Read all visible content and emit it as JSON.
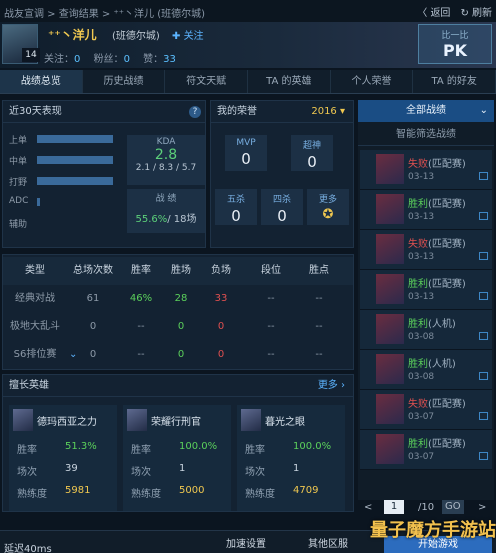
{
  "breadcrumb": "战友宣调 > 查询结果 > ⁺⁺丶洋儿 (班德尔城)",
  "top_right": {
    "back": "返回",
    "refresh": "刷新"
  },
  "player": {
    "level": "14",
    "name": "⁺⁺丶洋儿",
    "server": "(班德尔城)",
    "follow": "关注",
    "fans_label": "关注：",
    "fans": "0",
    "followers_label": "粉丝：",
    "followers": "0",
    "likes_label": "赞：",
    "likes": "33"
  },
  "pk": {
    "sub": "比一比",
    "label": "PK"
  },
  "tabs": [
    "战绩总览",
    "历史战绩",
    "符文天赋",
    "TA 的英雄",
    "个人荣誉",
    "TA 的好友"
  ],
  "recent": {
    "title": "近30天表现",
    "roles": [
      "上单",
      "中单",
      "打野",
      "ADC",
      "辅助"
    ],
    "role_share": [
      0.9,
      0.9,
      0.9,
      0.03,
      0
    ],
    "kda_label": "KDA",
    "kda": "2.8",
    "kda_detail": "2.1 / 8.3 / 5.7",
    "record_label": "战 绩",
    "winrate": "55.6%",
    "games": "/ 18场"
  },
  "honor": {
    "title": "我的荣誉",
    "year": "2016",
    "items": [
      {
        "label": "MVP",
        "value": "0"
      },
      {
        "label": "超神",
        "value": "0"
      },
      {
        "label": "五杀",
        "value": "0"
      },
      {
        "label": "四杀",
        "value": "0"
      },
      {
        "label": "更多",
        "value": ""
      }
    ]
  },
  "filter": {
    "all": "全部战绩",
    "smart": "智能筛选战绩"
  },
  "matches": [
    {
      "result": "失败",
      "mode": "(匹配赛)",
      "date": "03-13",
      "win": false
    },
    {
      "result": "胜利",
      "mode": "(匹配赛)",
      "date": "03-13",
      "win": true
    },
    {
      "result": "失败",
      "mode": "(匹配赛)",
      "date": "03-13",
      "win": false
    },
    {
      "result": "胜利",
      "mode": "(匹配赛)",
      "date": "03-13",
      "win": true
    },
    {
      "result": "胜利",
      "mode": "(人机)",
      "date": "03-08",
      "win": true
    },
    {
      "result": "胜利",
      "mode": "(人机)",
      "date": "03-08",
      "win": true
    },
    {
      "result": "失败",
      "mode": "(匹配赛)",
      "date": "03-07",
      "win": false
    },
    {
      "result": "胜利",
      "mode": "(匹配赛)",
      "date": "03-07",
      "win": true
    }
  ],
  "pager": {
    "prev": "<",
    "page": "1",
    "total": "/10",
    "go": "GO",
    "next": ">"
  },
  "table": {
    "headers": [
      "类型",
      "总场次数",
      "胜率",
      "胜场",
      "负场",
      "段位",
      "胜点"
    ],
    "rows": [
      [
        "经典对战",
        "61",
        "46%",
        "28",
        "33",
        "--",
        "--"
      ],
      [
        "极地大乱斗",
        "0",
        "--",
        "0",
        "0",
        "--",
        "--"
      ],
      [
        "S6排位赛",
        "0",
        "--",
        "0",
        "0",
        "--",
        "--"
      ]
    ]
  },
  "heroes": {
    "title": "擅长英雄",
    "more": "更多",
    "list": [
      {
        "name": "德玛西亚之力",
        "winrate": "51.3%",
        "games": "39",
        "mastery": "5981"
      },
      {
        "name": "荣耀行刑官",
        "winrate": "100.0%",
        "games": "1",
        "mastery": "5000"
      },
      {
        "name": "暮光之眼",
        "winrate": "100.0%",
        "games": "1",
        "mastery": "4709"
      }
    ],
    "labels": {
      "winrate": "胜率",
      "games": "场次",
      "mastery": "熟练度"
    }
  },
  "bottom": {
    "latency": "延迟40ms",
    "speed": "加速设置",
    "other": "其他区服",
    "start": "开始游戏"
  },
  "watermark": "量子魔方手游站",
  "colors": {
    "win": "#5bd05b",
    "loss": "#e05050",
    "accent": "#5cb4ff",
    "gold": "#f0c850"
  }
}
